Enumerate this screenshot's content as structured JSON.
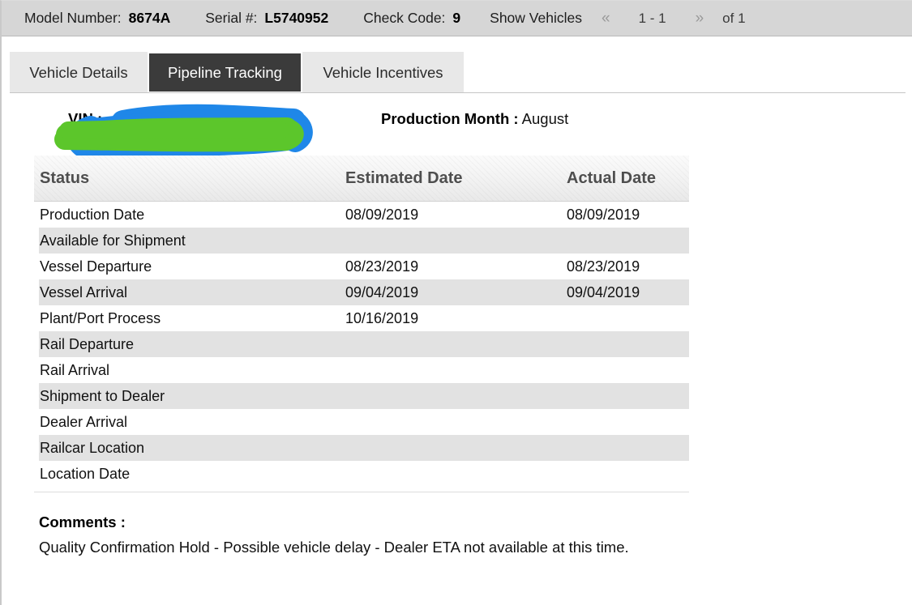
{
  "top_bar": {
    "model_number_label": "Model Number:",
    "model_number_value": "8674A",
    "serial_label": "Serial #:",
    "serial_value": "L5740952",
    "check_code_label": "Check Code:",
    "check_code_value": "9",
    "show_vehicles_label": "Show Vehicles",
    "prev_arrow": "«",
    "next_arrow": "»",
    "range_text": "1 - 1",
    "of_text": "of 1"
  },
  "tabs": [
    {
      "id": "vehicle-details",
      "label": "Vehicle Details",
      "active": false
    },
    {
      "id": "pipeline-tracking",
      "label": "Pipeline Tracking",
      "active": true
    },
    {
      "id": "vehicle-incentives",
      "label": "Vehicle Incentives",
      "active": false
    }
  ],
  "vehicle": {
    "vin_label": "VIN :",
    "vin_value": "",
    "vin_redacted": true,
    "production_month_label": "Production Month :",
    "production_month_value": "August"
  },
  "redaction": {
    "blue_color": "#1f87e8",
    "green_color": "#5cc62b"
  },
  "table": {
    "columns": [
      "Status",
      "Estimated Date",
      "Actual Date"
    ],
    "rows": [
      {
        "status": "Production Date",
        "estimated": "08/09/2019",
        "actual": "08/09/2019"
      },
      {
        "status": "Available for Shipment",
        "estimated": "",
        "actual": ""
      },
      {
        "status": "Vessel Departure",
        "estimated": "08/23/2019",
        "actual": "08/23/2019"
      },
      {
        "status": "Vessel Arrival",
        "estimated": "09/04/2019",
        "actual": "09/04/2019"
      },
      {
        "status": "Plant/Port Process",
        "estimated": "10/16/2019",
        "actual": ""
      },
      {
        "status": "Rail Departure",
        "estimated": "",
        "actual": ""
      },
      {
        "status": "Rail Arrival",
        "estimated": "",
        "actual": ""
      },
      {
        "status": "Shipment to Dealer",
        "estimated": "",
        "actual": ""
      },
      {
        "status": "Dealer Arrival",
        "estimated": "",
        "actual": ""
      },
      {
        "status": "Railcar Location",
        "estimated": "",
        "actual": ""
      },
      {
        "status": "Location Date",
        "estimated": "",
        "actual": ""
      }
    ]
  },
  "comments": {
    "label": "Comments :",
    "text": "Quality Confirmation Hold - Possible vehicle delay - Dealer ETA not available at this time."
  }
}
